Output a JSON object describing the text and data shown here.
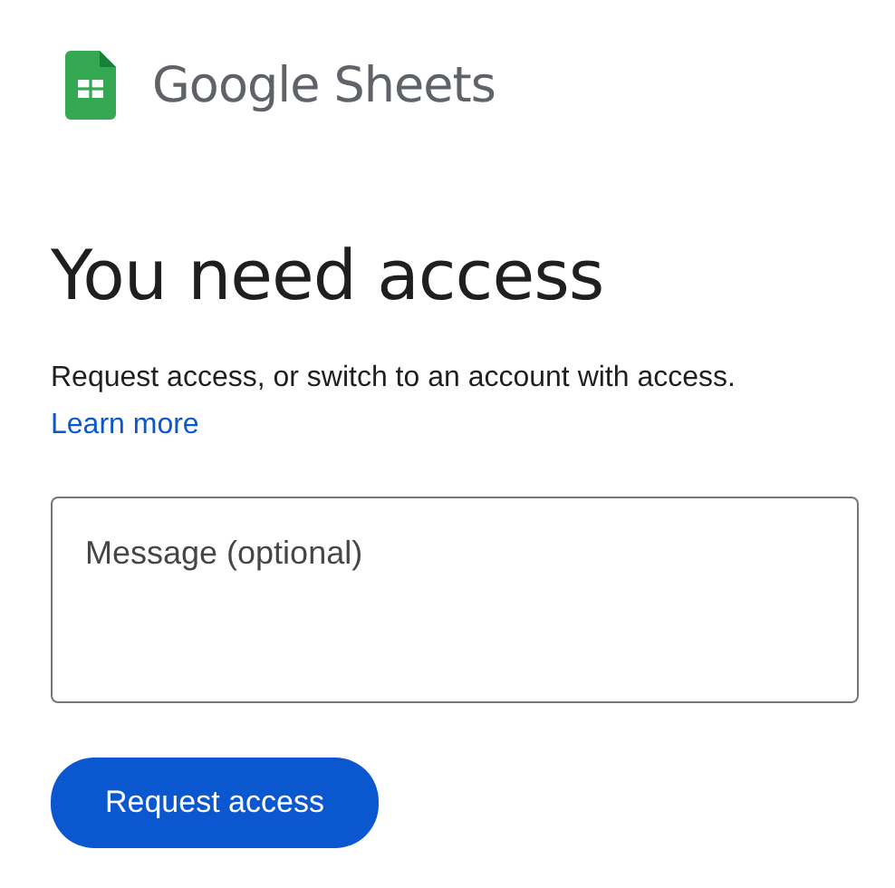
{
  "header": {
    "product": "Google Sheets"
  },
  "title": "You need access",
  "description": "Request access, or switch to an account with access.",
  "learn_more_link": "Learn more",
  "message_field": {
    "placeholder": "Message (optional)"
  },
  "submit_button": "Request access"
}
